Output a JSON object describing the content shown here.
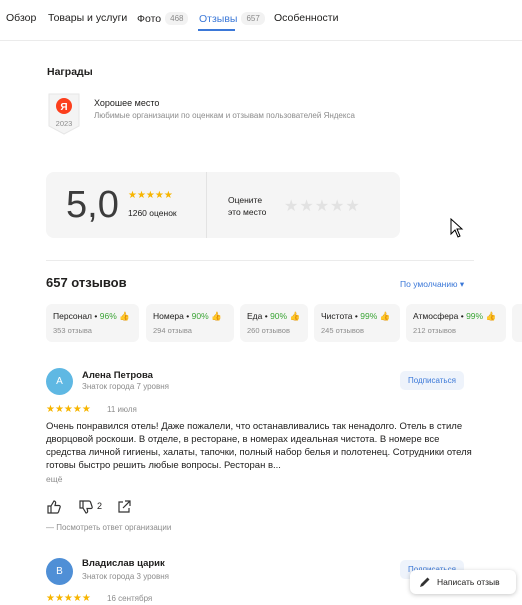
{
  "tabs": [
    {
      "label": "Обзор"
    },
    {
      "label": "Товары и услуги"
    },
    {
      "label": "Фото",
      "count": "468"
    },
    {
      "label": "Отзывы",
      "count": "657"
    },
    {
      "label": "Особенности"
    }
  ],
  "awards": {
    "title": "Награды",
    "badge_letter": "Я",
    "badge_year": "2023",
    "name": "Хорошее место",
    "description": "Любимые организации по оценкам и отзывам пользователей Яндекса"
  },
  "rating": {
    "value": "5,0",
    "stars": "★★★★★",
    "count_text": "1260 оценок",
    "rate_label_line1": "Оцените",
    "rate_label_line2": "это место",
    "rate_stars": "★★★★★"
  },
  "reviews": {
    "count_title": "657 отзывов",
    "sort_label": "По умолчанию ▾"
  },
  "aspects": [
    {
      "name": "Персонал",
      "percent": "96%",
      "count": "353 отзыва"
    },
    {
      "name": "Номера",
      "percent": "90%",
      "count": "294 отзыва"
    },
    {
      "name": "Еда",
      "percent": "90%",
      "count": "260 отзывов"
    },
    {
      "name": "Чистота",
      "percent": "99%",
      "count": "245 отзывов"
    },
    {
      "name": "Атмосфера",
      "percent": "99%",
      "count": "212 отзывов"
    }
  ],
  "review1": {
    "avatar_letter": "А",
    "author": "Алена Петрова",
    "level": "Знаток города 7 уровня",
    "subscribe": "Подписаться",
    "stars": "★★★★★",
    "date": "11 июля",
    "text": "Очень понравился отель! Даже пожалели, что останавливались так ненадолго. Отель в стиле дворцовой роскоши. В отделе, в ресторане, в номерах идеальная чистота. В номере все средства личной гигиены, халаты, тапочки, полный набор белья и полотенец. Сотрудники отеля готовы быстро решить любые вопросы. Ресторан в...",
    "more": "ещё",
    "dislikes": "2",
    "org_reply": "— Посмотреть ответ организации"
  },
  "review2": {
    "avatar_letter": "В",
    "author": "Владислав царик",
    "level": "Знаток города 3 уровня",
    "subscribe": "Подписаться",
    "stars": "★★★★★",
    "date": "16 сентября"
  },
  "write_review": "Написать отзыв",
  "colors": {
    "accent": "#3b78d8",
    "star": "#f7b500",
    "positive": "#3ba536",
    "avatar1": "#5fb8e3",
    "avatar2": "#4f8fd6"
  }
}
